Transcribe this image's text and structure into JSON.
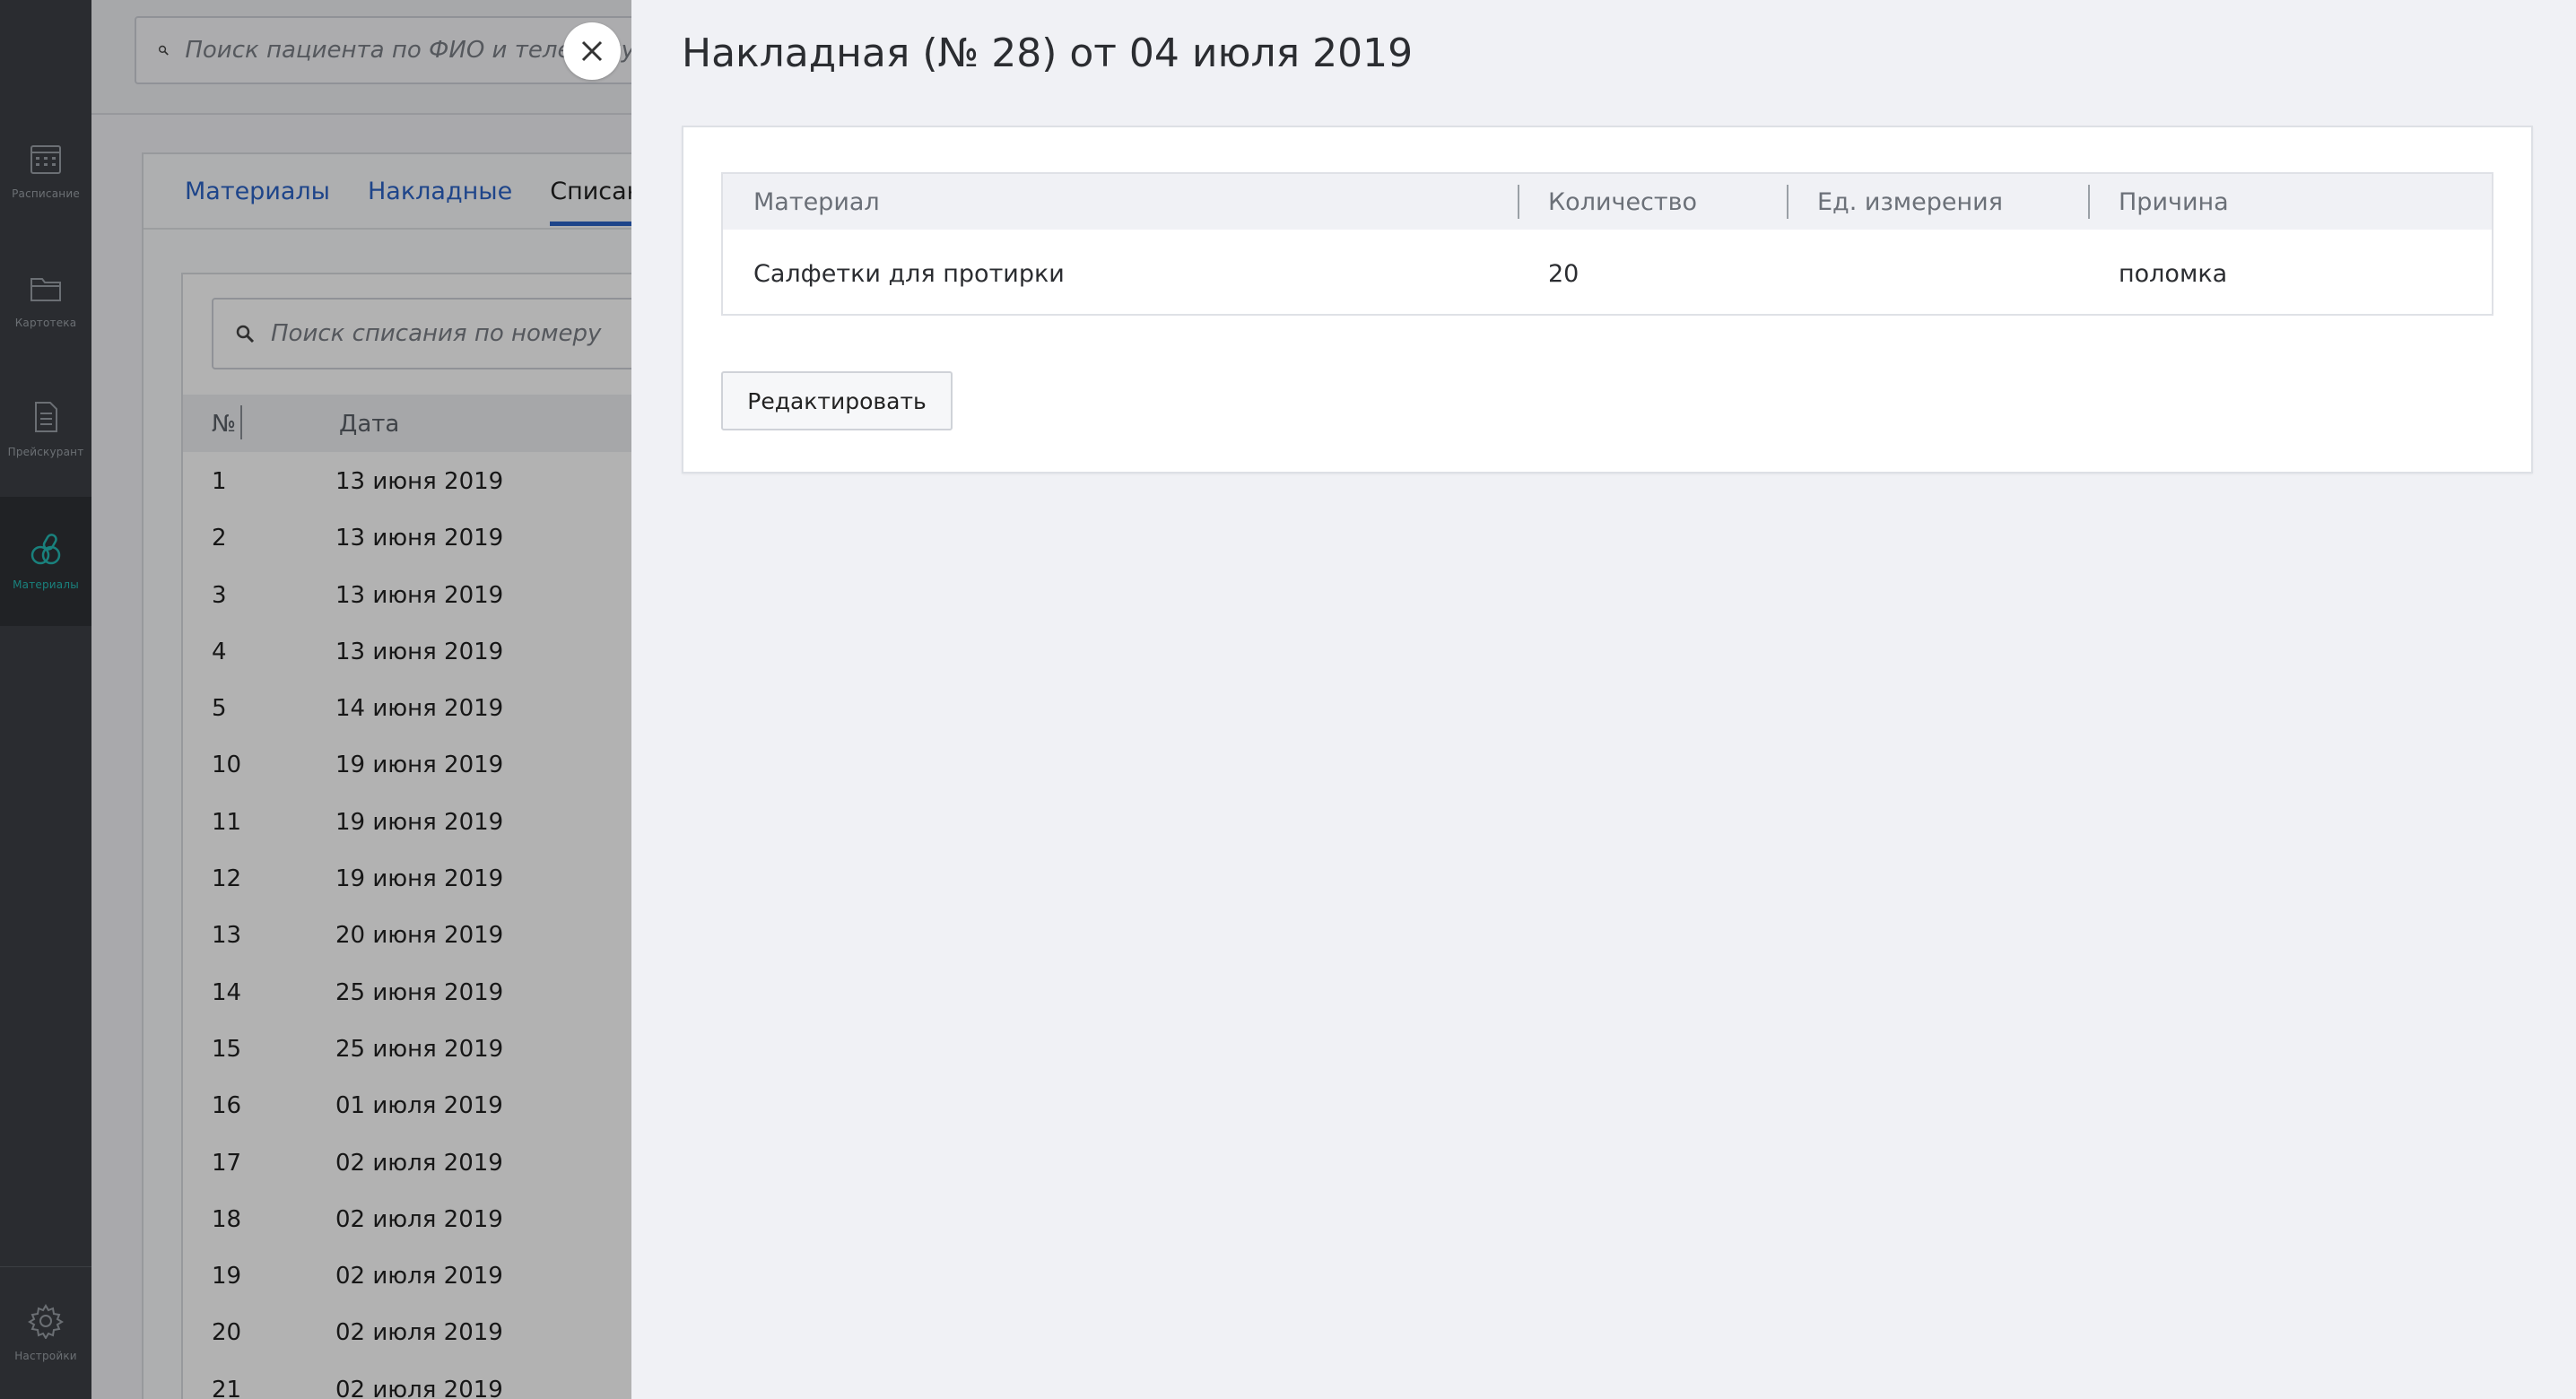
{
  "sidebar": {
    "items": [
      {
        "label": "Расписание",
        "icon": "calendar-icon"
      },
      {
        "label": "Картотека",
        "icon": "folder-icon"
      },
      {
        "label": "Прейскурант",
        "icon": "document-icon"
      },
      {
        "label": "Материалы",
        "icon": "pills-icon",
        "active": true
      }
    ],
    "settings_label": "Настройки"
  },
  "background": {
    "search_placeholder": "Поиск пациента по ФИО и телефону",
    "tabs": [
      "Материалы",
      "Накладные",
      "Списания"
    ],
    "active_tab": "Списания",
    "writeoff_search_placeholder": "Поиск списания по номеру",
    "columns": [
      "№",
      "Дата"
    ],
    "rows": [
      {
        "num": "1",
        "date": "13 июня 2019"
      },
      {
        "num": "2",
        "date": "13 июня 2019"
      },
      {
        "num": "3",
        "date": "13 июня 2019"
      },
      {
        "num": "4",
        "date": "13 июня 2019"
      },
      {
        "num": "5",
        "date": "14 июня 2019"
      },
      {
        "num": "10",
        "date": "19 июня 2019"
      },
      {
        "num": "11",
        "date": "19 июня 2019"
      },
      {
        "num": "12",
        "date": "19 июня 2019"
      },
      {
        "num": "13",
        "date": "20 июня 2019"
      },
      {
        "num": "14",
        "date": "25 июня 2019"
      },
      {
        "num": "15",
        "date": "25 июня 2019"
      },
      {
        "num": "16",
        "date": "01 июля 2019"
      },
      {
        "num": "17",
        "date": "02 июля 2019"
      },
      {
        "num": "18",
        "date": "02 июля 2019"
      },
      {
        "num": "19",
        "date": "02 июля 2019"
      },
      {
        "num": "20",
        "date": "02 июля 2019"
      },
      {
        "num": "21",
        "date": "02 июля 2019"
      }
    ]
  },
  "panel": {
    "title": "Накладная (№ 28) от 04 июля 2019",
    "table": {
      "columns": [
        "Материал",
        "Количество",
        "Ед. измерения",
        "Причина"
      ],
      "rows": [
        {
          "material": "Салфетки для протирки",
          "quantity": "20",
          "unit": "",
          "reason": "поломка"
        }
      ]
    },
    "edit_label": "Редактировать"
  },
  "colors": {
    "sidebar_bg": "#3d4045",
    "accent": "#25b9b3",
    "link": "#2c63c6"
  }
}
